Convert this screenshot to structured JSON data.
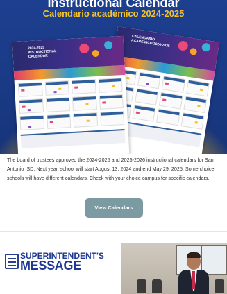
{
  "hero": {
    "title": "Instructional Calendar",
    "subtitle": "Calendario académico 2024-2025",
    "front_sheet_title": "2024-2025 INSTRUCTIONAL CALENDAR",
    "back_sheet_title": "CALENDARIO ACADÉMICO 2024-2025"
  },
  "article": {
    "body": "The board of trustees approved the 2024-2025 and 2025-2026 instructional calendars for San Antonio ISD. Next year, school will start August 13, 2024 and end May 29, 2025. Some choice schools will have different calendars. Check with your choice campus for specific calendars.",
    "cta_label": "View Calendars"
  },
  "message": {
    "line1": "SUPERINTENDENT'S",
    "line2": "MESSAGE"
  },
  "colors": {
    "hero_blue": "#1d3f8f",
    "accent_yellow": "#f6c325",
    "cta_gray_teal": "#7b9aa2",
    "brand_navy": "#1f3892"
  }
}
